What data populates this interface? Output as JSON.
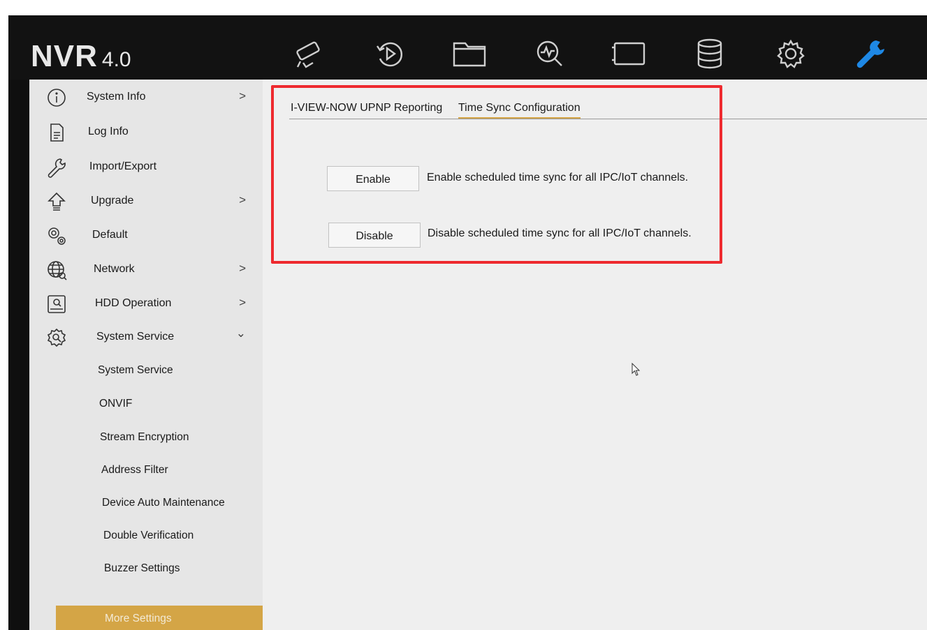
{
  "app": {
    "logo_main": "NVR",
    "logo_version": "4.0"
  },
  "topbar": {
    "icons": [
      "camera-icon",
      "playback-icon",
      "folder-icon",
      "search-analytics-icon",
      "video-wall-icon",
      "storage-icon",
      "gear-icon",
      "wrench-icon"
    ],
    "active_icon": "wrench-icon",
    "active_color": "#1e88e5"
  },
  "sidebar": {
    "items": [
      {
        "label": "System Info",
        "icon": "info-icon",
        "arrow": ">"
      },
      {
        "label": "Log Info",
        "icon": "document-icon"
      },
      {
        "label": "Import/Export",
        "icon": "import-export-icon"
      },
      {
        "label": "Upgrade",
        "icon": "upgrade-icon",
        "arrow": ">"
      },
      {
        "label": "Default",
        "icon": "default-icon"
      },
      {
        "label": "Network",
        "icon": "network-icon",
        "arrow": ">"
      },
      {
        "label": "HDD Operation",
        "icon": "hdd-icon",
        "arrow": ">"
      },
      {
        "label": "System Service",
        "icon": "system-service-icon",
        "arrow": "⌄"
      }
    ],
    "sub_items": [
      "System Service",
      "ONVIF",
      "Stream Encryption",
      "Address Filter",
      "Device Auto Maintenance",
      "Double Verification",
      "Buzzer Settings"
    ],
    "selected": "More Settings",
    "selected_color": "#d4a546"
  },
  "main": {
    "tabs": [
      {
        "label": "I-VIEW-NOW UPNP Reporting"
      },
      {
        "label": "Time Sync Configuration"
      }
    ],
    "active_tab": "Time Sync Configuration",
    "enable_button": "Enable",
    "enable_desc": "Enable scheduled time sync for all IPC/IoT channels.",
    "disable_button": "Disable",
    "disable_desc": "Disable scheduled time sync for all IPC/IoT channels."
  },
  "colors": {
    "highlight_border": "#ee2a2f",
    "accent": "#d4a546"
  }
}
